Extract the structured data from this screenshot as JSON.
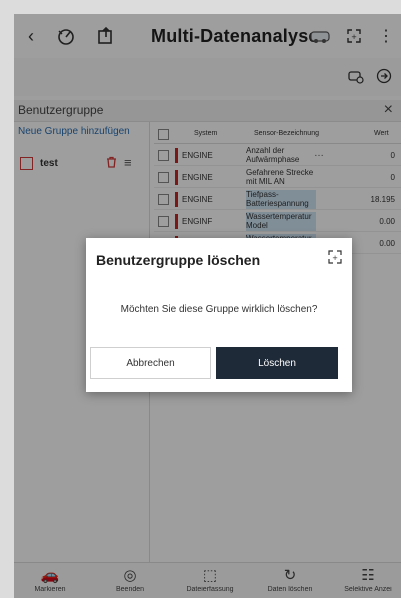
{
  "header": {
    "title": "Multi-Datenanalyse",
    "back_icon": "chevron-left-icon",
    "gauge_icon": "gauge-icon",
    "export_icon": "export-icon",
    "car_icon": "car-icon",
    "expand_icon": "expand-icon"
  },
  "sub_toolbar": {
    "icons": [
      "car-diagnostic-icon",
      "arrow-right-circle-icon"
    ]
  },
  "group_panel": {
    "title": "Benutzergruppe",
    "new_group_label": "Neue Gruppe hinzufügen",
    "groups": [
      {
        "label": "test"
      }
    ]
  },
  "table": {
    "columns": [
      "System",
      "Sensor-Bezeichnung",
      "Wert"
    ],
    "rows": [
      {
        "system": "ENGINE",
        "name": "Anzahl der Aufwärmphase",
        "value": "0",
        "highlight": false,
        "has_more": true
      },
      {
        "system": "ENGINE",
        "name": "Gefahrene Strecke mit MIL AN",
        "value": "0",
        "highlight": false,
        "has_more": false
      },
      {
        "system": "ENGINE",
        "name": "Tiefpass-Batteriespannung",
        "value": "18.195",
        "highlight": true,
        "has_more": false
      },
      {
        "system": "ENGINF",
        "name": "Wassertemperatur Model",
        "value": "0.00",
        "highlight": true,
        "has_more": false
      },
      {
        "system": "ENGINE",
        "name": "Wassertemperatur beim Anlassen",
        "value": "0.00",
        "highlight": true,
        "has_more": false
      }
    ]
  },
  "bottom_nav": {
    "items": [
      {
        "icon": "car-icon",
        "label": "Markieren"
      },
      {
        "icon": "record-icon",
        "label": "Beenden"
      },
      {
        "icon": "fullscreen-icon",
        "label": "Dateierfassung"
      },
      {
        "icon": "refresh-icon",
        "label": "Daten löschen"
      },
      {
        "icon": "selective-icon",
        "label": "Selektive Anzei"
      }
    ]
  },
  "dialog": {
    "title": "Benutzergruppe löschen",
    "message": "Möchten Sie diese Gruppe wirklich löschen?",
    "cancel_label": "Abbrechen",
    "confirm_label": "Löschen"
  },
  "colors": {
    "accent_dark": "#1f2a38",
    "system_marker": "#c62828",
    "highlight": "#cfe6f6",
    "link": "#2a6fb3"
  }
}
